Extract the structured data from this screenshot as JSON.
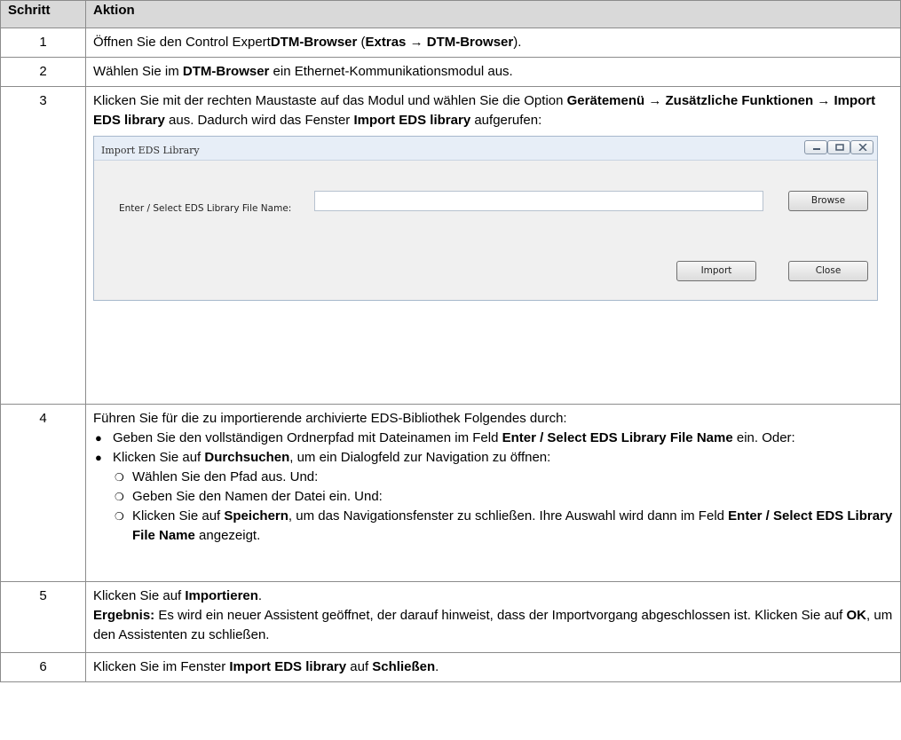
{
  "header": {
    "col_step": "Schritt",
    "col_action": "Aktion"
  },
  "rows": [
    {
      "num": "1"
    },
    {
      "num": "2"
    },
    {
      "num": "3"
    },
    {
      "num": "4"
    },
    {
      "num": "5"
    },
    {
      "num": "6"
    }
  ],
  "row1": {
    "t1": "Öffnen Sie den Control Expert",
    "b1": "DTM-Browser",
    "t2": " (",
    "b2": "Extras → DTM-Browser",
    "t3": ")."
  },
  "row2": {
    "t1": "Wählen Sie im ",
    "b1": "DTM-Browser",
    "t2": " ein Ethernet-Kommunikationsmodul aus."
  },
  "row3": {
    "t1": "Klicken Sie mit der rechten Maustaste auf das Modul und wählen Sie die Option ",
    "b1": "Gerätemenü → Zusätzliche Funktionen → Import EDS library",
    "t2": " aus. Dadurch wird das Fenster ",
    "b2": "Import EDS library",
    "t3": " aufgerufen:"
  },
  "dialog": {
    "title": "Import EDS Library",
    "field_label": "Enter / Select EDS Library File Name:",
    "field_value": "",
    "browse_label": "Browse",
    "import_label": "Import",
    "close_label": "Close"
  },
  "row4": {
    "intro": "Führen Sie für die zu importierende archivierte EDS-Bibliothek Folgendes durch:",
    "b1_t1": "Geben Sie den vollständigen Ordnerpfad mit Dateinamen im Feld ",
    "b1_b1": "Enter / Select EDS Library File Name",
    "b1_t2": " ein. Oder:",
    "b2_t1": "Klicken Sie auf ",
    "b2_b1": "Durchsuchen",
    "b2_t2": ", um ein Dialogfeld zur Navigation zu öffnen:",
    "s1": "Wählen Sie den Pfad aus. Und:",
    "s2": "Geben Sie den Namen der Datei ein. Und:",
    "s3_t1": "Klicken Sie auf ",
    "s3_b1": "Speichern",
    "s3_t2": ", um das Navigationsfenster zu schließen. Ihre Auswahl wird dann im Feld ",
    "s3_b2": "Enter / Select EDS Library File Name",
    "s3_t3": " angezeigt."
  },
  "row5": {
    "t1": "Klicken Sie auf ",
    "b1": "Importieren",
    "t2": ".",
    "r_b": "Ergebnis:",
    "r_t1": " Es wird ein neuer Assistent geöffnet, der darauf hinweist, dass der Importvorgang abgeschlossen ist. Klicken Sie auf ",
    "r_b2": "OK",
    "r_t2": ", um den Assistenten zu schließen."
  },
  "row6": {
    "t1": "Klicken Sie im Fenster ",
    "b1": "Import EDS library",
    "t2": " auf ",
    "b2": "Schließen",
    "t3": "."
  }
}
